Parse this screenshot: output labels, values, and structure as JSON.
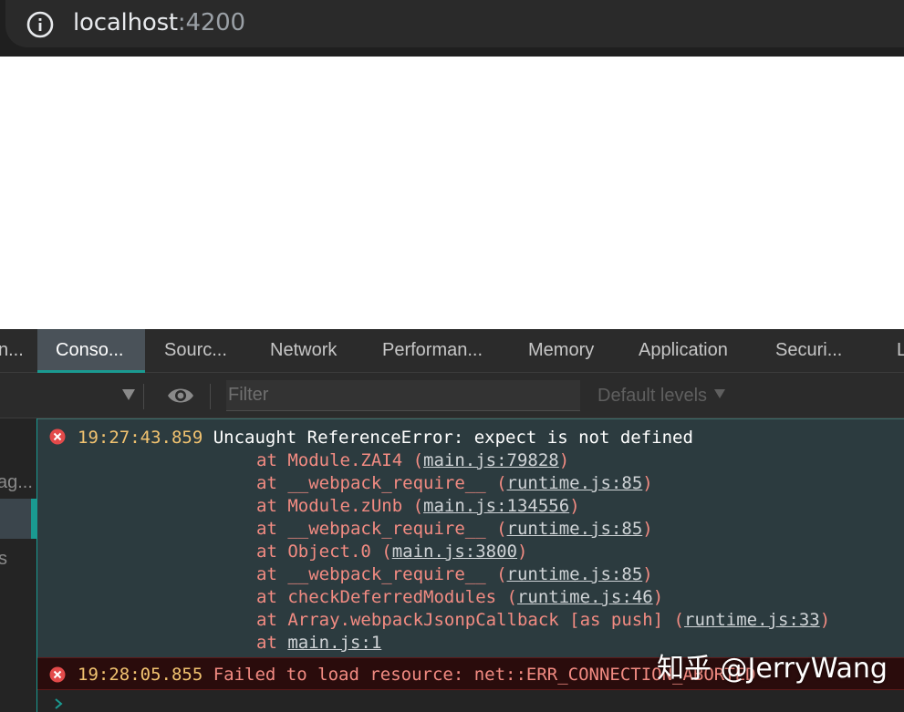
{
  "browser": {
    "url_host": "localhost",
    "url_port": ":4200"
  },
  "devtools": {
    "tabs": [
      {
        "label": "n...",
        "active": false
      },
      {
        "label": "Conso...",
        "active": true
      },
      {
        "label": "Sourc...",
        "active": false
      },
      {
        "label": "Network",
        "active": false
      },
      {
        "label": "Performan...",
        "active": false
      },
      {
        "label": "Memory",
        "active": false
      },
      {
        "label": "Application",
        "active": false
      },
      {
        "label": "Securi...",
        "active": false
      },
      {
        "label": "L",
        "active": false
      }
    ],
    "toolbar": {
      "filter_placeholder": "Filter",
      "levels_label": "Default levels"
    },
    "sidebar": {
      "items": [
        "ag...",
        "s"
      ]
    },
    "messages": [
      {
        "timestamp": "19:27:43.859",
        "text": "Uncaught ReferenceError: expect is not defined",
        "stack": [
          {
            "prefix": "at Module.ZAI4 (",
            "link": "main.js:79828",
            "suffix": ")"
          },
          {
            "prefix": "at __webpack_require__ (",
            "link": "runtime.js:85",
            "suffix": ")"
          },
          {
            "prefix": "at Module.zUnb (",
            "link": "main.js:134556",
            "suffix": ")"
          },
          {
            "prefix": "at __webpack_require__ (",
            "link": "runtime.js:85",
            "suffix": ")"
          },
          {
            "prefix": "at Object.0 (",
            "link": "main.js:3800",
            "suffix": ")"
          },
          {
            "prefix": "at __webpack_require__ (",
            "link": "runtime.js:85",
            "suffix": ")"
          },
          {
            "prefix": "at checkDeferredModules (",
            "link": "runtime.js:46",
            "suffix": ")"
          },
          {
            "prefix": "at Array.webpackJsonpCallback [as push] (",
            "link": "runtime.js:33",
            "suffix": ")"
          },
          {
            "prefix": "at ",
            "link": "main.js:1",
            "suffix": ""
          }
        ]
      },
      {
        "timestamp": "19:28:05.855",
        "text": "Failed to load resource: net::ERR_CONNECTION_ABORTED"
      }
    ]
  },
  "watermark": "知乎 @JerryWang",
  "colors": {
    "accent": "#1a9a91",
    "error_text": "#f28b82",
    "timestamp": "#f2c370",
    "error_bg": "#2a0c0c"
  }
}
